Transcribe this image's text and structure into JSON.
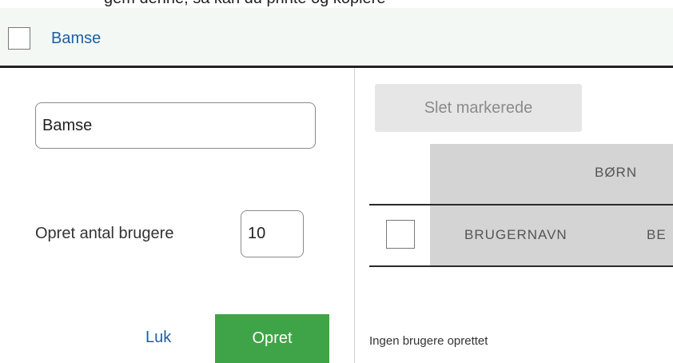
{
  "top_cut_text": "gem denne, så kan du printe og kopiere",
  "header": {
    "title": "Bamse"
  },
  "form": {
    "name_value": "Bamse",
    "count_label": "Opret antal brugere",
    "count_value": "10",
    "close_label": "Luk",
    "create_label": "Opret"
  },
  "users_table": {
    "delete_selected_label": "Slet markerede",
    "group_header": "BØRN",
    "columns": [
      "BRUGERNAVN",
      "BE"
    ],
    "empty_message": "Ingen brugere oprettet"
  },
  "colors": {
    "accent_link": "#1d5fa3",
    "create_button": "#3fa447",
    "header_bg": "#f4f8f5",
    "table_header_bg": "#d4d4d4"
  }
}
